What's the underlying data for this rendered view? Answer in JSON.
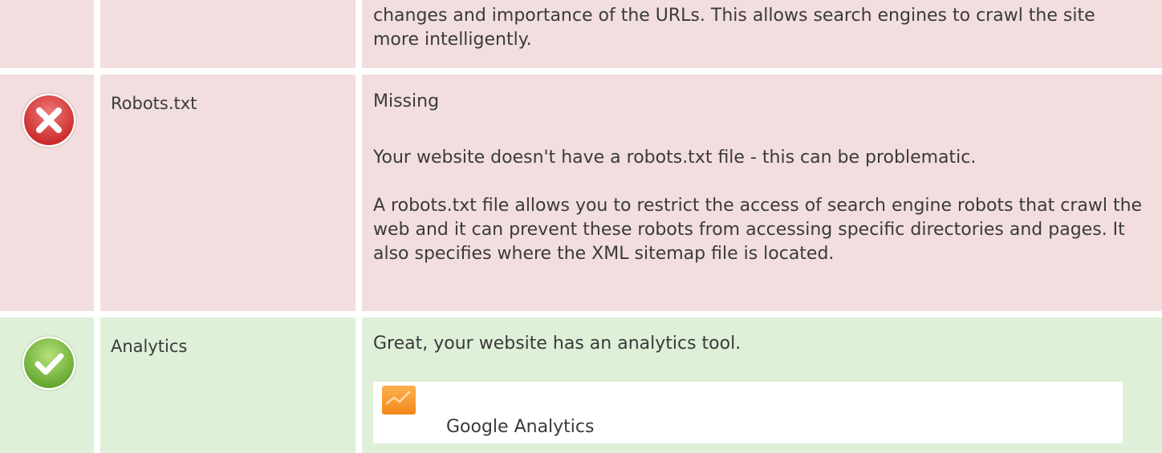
{
  "colors": {
    "error_row": "#f2dede",
    "success_row": "#def0d8",
    "error_icon": "#e03a3a",
    "success_icon": "#7cc043",
    "text": "#3a3a3a",
    "tool_icon": "#f89a2c"
  },
  "rows": {
    "sitemap": {
      "description_tail": "changes and importance of the URLs. This allows search engines to crawl the site more intelligently."
    },
    "robots": {
      "icon": "error-x-icon",
      "name": "Robots.txt",
      "status": "Missing",
      "para1": "Your website doesn't have a robots.txt file - this can be problematic.",
      "para2": "A robots.txt file allows you to restrict the access of search engine robots that crawl the web and it can prevent these robots from accessing specific directories and pages. It also specifies where the XML sitemap file is located."
    },
    "analytics": {
      "icon": "success-check-icon",
      "name": "Analytics",
      "message": "Great, your website has an analytics tool.",
      "tool": {
        "icon": "google-analytics-icon",
        "label": "Google Analytics"
      }
    }
  }
}
